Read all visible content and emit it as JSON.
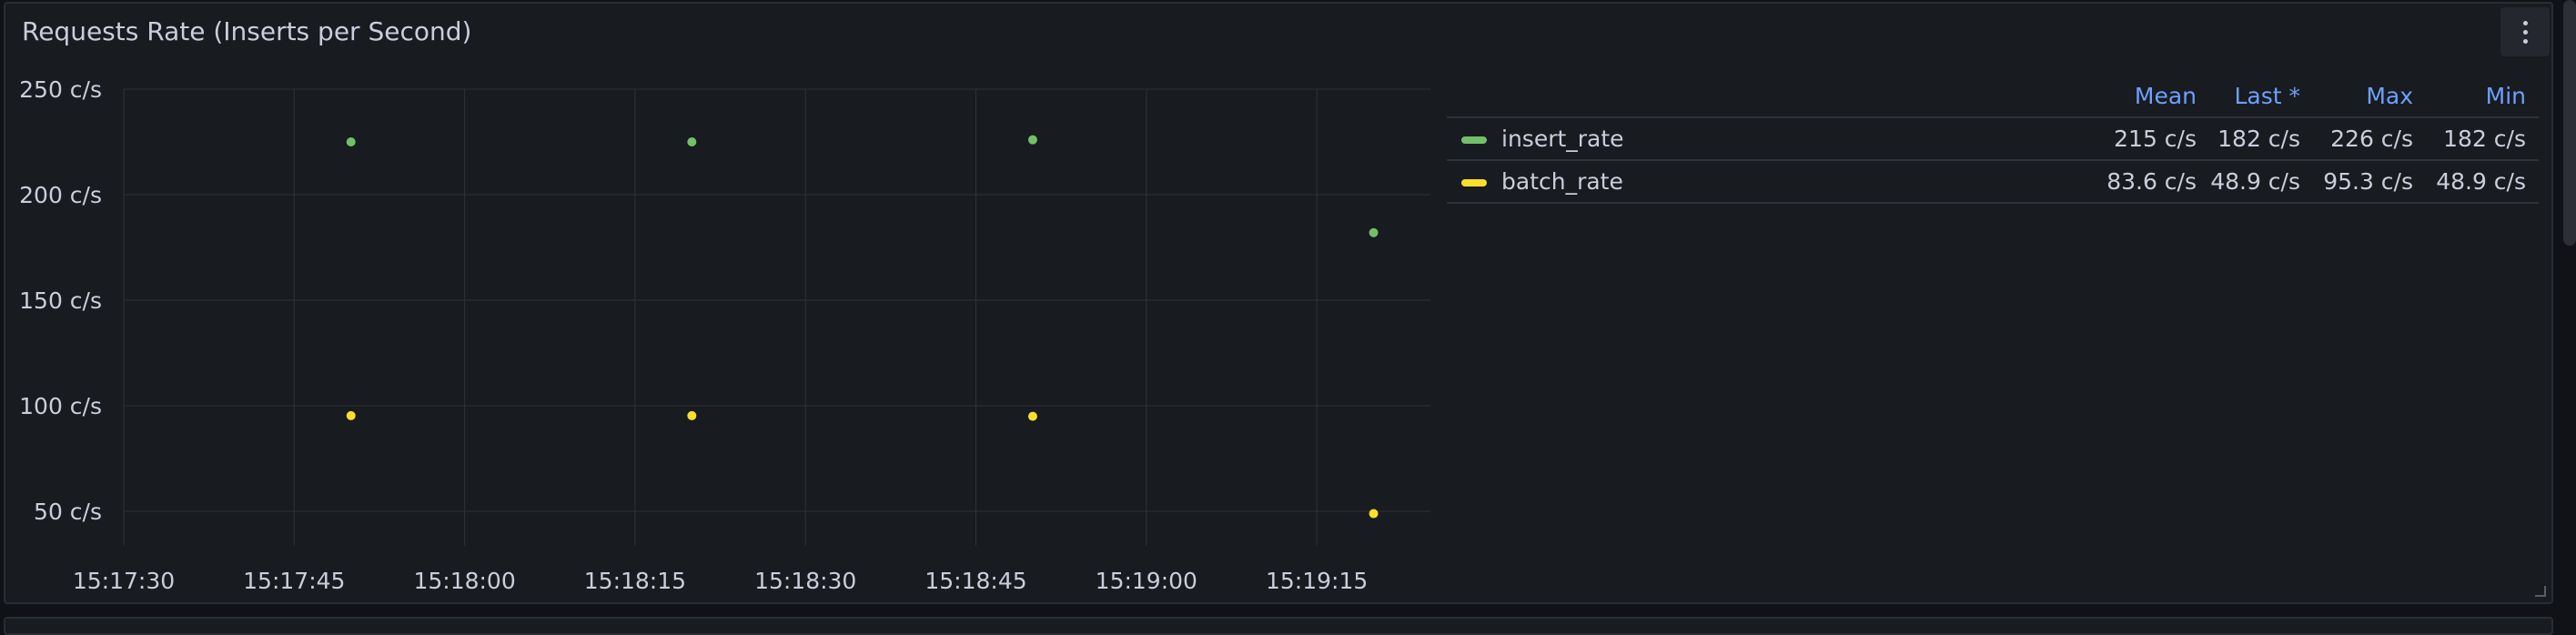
{
  "panel": {
    "title": "Requests Rate (Inserts per Second)",
    "menu_icon": "more-vertical-icon"
  },
  "colors": {
    "background": "#181b1f",
    "grid": "#2f3238",
    "text": "#ccccdc",
    "header_text": "#6e9fff",
    "insert_rate": "#73bf69",
    "batch_rate": "#fade2a"
  },
  "legend": {
    "headers": [
      "Mean",
      "Last *",
      "Max",
      "Min"
    ],
    "rows": [
      {
        "name": "insert_rate",
        "mean": "215 c/s",
        "last": "182 c/s",
        "max": "226 c/s",
        "min": "182 c/s"
      },
      {
        "name": "batch_rate",
        "mean": "83.6 c/s",
        "last": "48.9 c/s",
        "max": "95.3 c/s",
        "min": "48.9 c/s"
      }
    ]
  },
  "chart_data": {
    "type": "scatter",
    "title": "Requests Rate (Inserts per Second)",
    "xlabel": "",
    "ylabel": "",
    "x_ticks": [
      "15:17:30",
      "15:17:45",
      "15:18:00",
      "15:18:15",
      "15:18:30",
      "15:18:45",
      "15:19:00",
      "15:19:15"
    ],
    "y_ticks": [
      "50 c/s",
      "100 c/s",
      "150 c/s",
      "200 c/s",
      "250 c/s"
    ],
    "y_tick_values": [
      50,
      100,
      150,
      200,
      250
    ],
    "ylim": [
      50,
      250
    ],
    "xlim": [
      "15:17:30",
      "15:19:25"
    ],
    "grid": true,
    "legend_placement": "right",
    "series": [
      {
        "name": "insert_rate",
        "x": [
          "15:17:50",
          "15:18:20",
          "15:18:50",
          "15:19:20"
        ],
        "values": [
          225,
          225,
          226,
          182
        ]
      },
      {
        "name": "batch_rate",
        "x": [
          "15:17:50",
          "15:18:20",
          "15:18:50",
          "15:19:20"
        ],
        "values": [
          95.3,
          95.3,
          95,
          48.9
        ]
      }
    ]
  }
}
